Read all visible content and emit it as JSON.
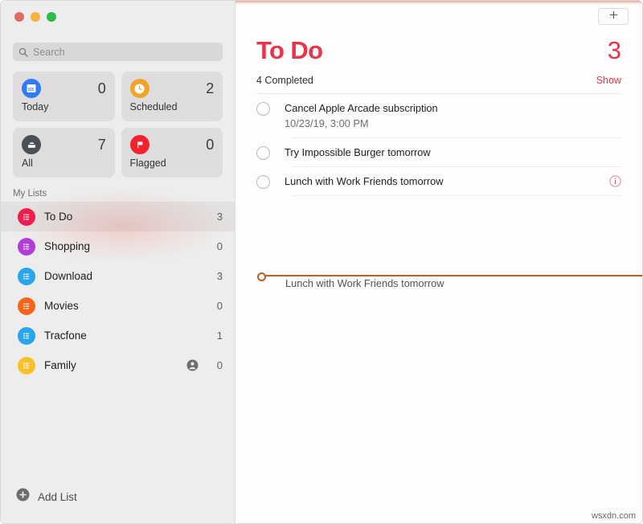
{
  "window": {
    "traffic_lights": [
      "close",
      "minimize",
      "maximize"
    ]
  },
  "sidebar": {
    "search": {
      "placeholder": "Search",
      "value": "",
      "icon": "search-icon"
    },
    "smart_lists": [
      {
        "label": "Today",
        "count": "0",
        "icon": "calendar-icon",
        "color": "#2f7cf6"
      },
      {
        "label": "Scheduled",
        "count": "2",
        "icon": "clock-icon",
        "color": "#f0a429"
      },
      {
        "label": "All",
        "count": "7",
        "icon": "inbox-icon",
        "color": "#4a4f55"
      },
      {
        "label": "Flagged",
        "count": "0",
        "icon": "flag-icon",
        "color": "#f0232f"
      }
    ],
    "section_title": "My Lists",
    "lists": [
      {
        "label": "To Do",
        "count": "3",
        "color": "#ee1e4e",
        "selected": true,
        "shared": false
      },
      {
        "label": "Shopping",
        "count": "0",
        "color": "#b13fd6",
        "selected": false,
        "shared": false
      },
      {
        "label": "Download",
        "count": "3",
        "color": "#2aa4ec",
        "selected": false,
        "shared": false
      },
      {
        "label": "Movies",
        "count": "0",
        "color": "#f4661b",
        "selected": false,
        "shared": false
      },
      {
        "label": "Tracfone",
        "count": "1",
        "color": "#2aa4ec",
        "selected": false,
        "shared": false
      },
      {
        "label": "Family",
        "count": "0",
        "color": "#f8c12c",
        "selected": false,
        "shared": true
      }
    ],
    "add_list": {
      "label": "Add List",
      "icon": "plus-circle-icon"
    }
  },
  "main": {
    "add_button": {
      "icon": "plus-icon"
    },
    "title": "To Do",
    "title_count": "3",
    "accent_color": "#e8334a",
    "completed_text": "4 Completed",
    "show_link": "Show",
    "tasks": [
      {
        "title": "Cancel Apple Arcade subscription",
        "subtitle": "10/23/19, 3:00 PM",
        "checked": false,
        "has_info": false
      },
      {
        "title": "Try Impossible Burger tomorrow",
        "subtitle": "",
        "checked": false,
        "has_info": false
      },
      {
        "title": "Lunch with Work Friends tomorrow",
        "subtitle": "",
        "checked": false,
        "has_info": true
      }
    ],
    "drag": {
      "ghost_text": "Lunch with Work Friends tomorrow",
      "indicator_color": "#b85f22"
    }
  },
  "watermark": "wsxdn.com"
}
